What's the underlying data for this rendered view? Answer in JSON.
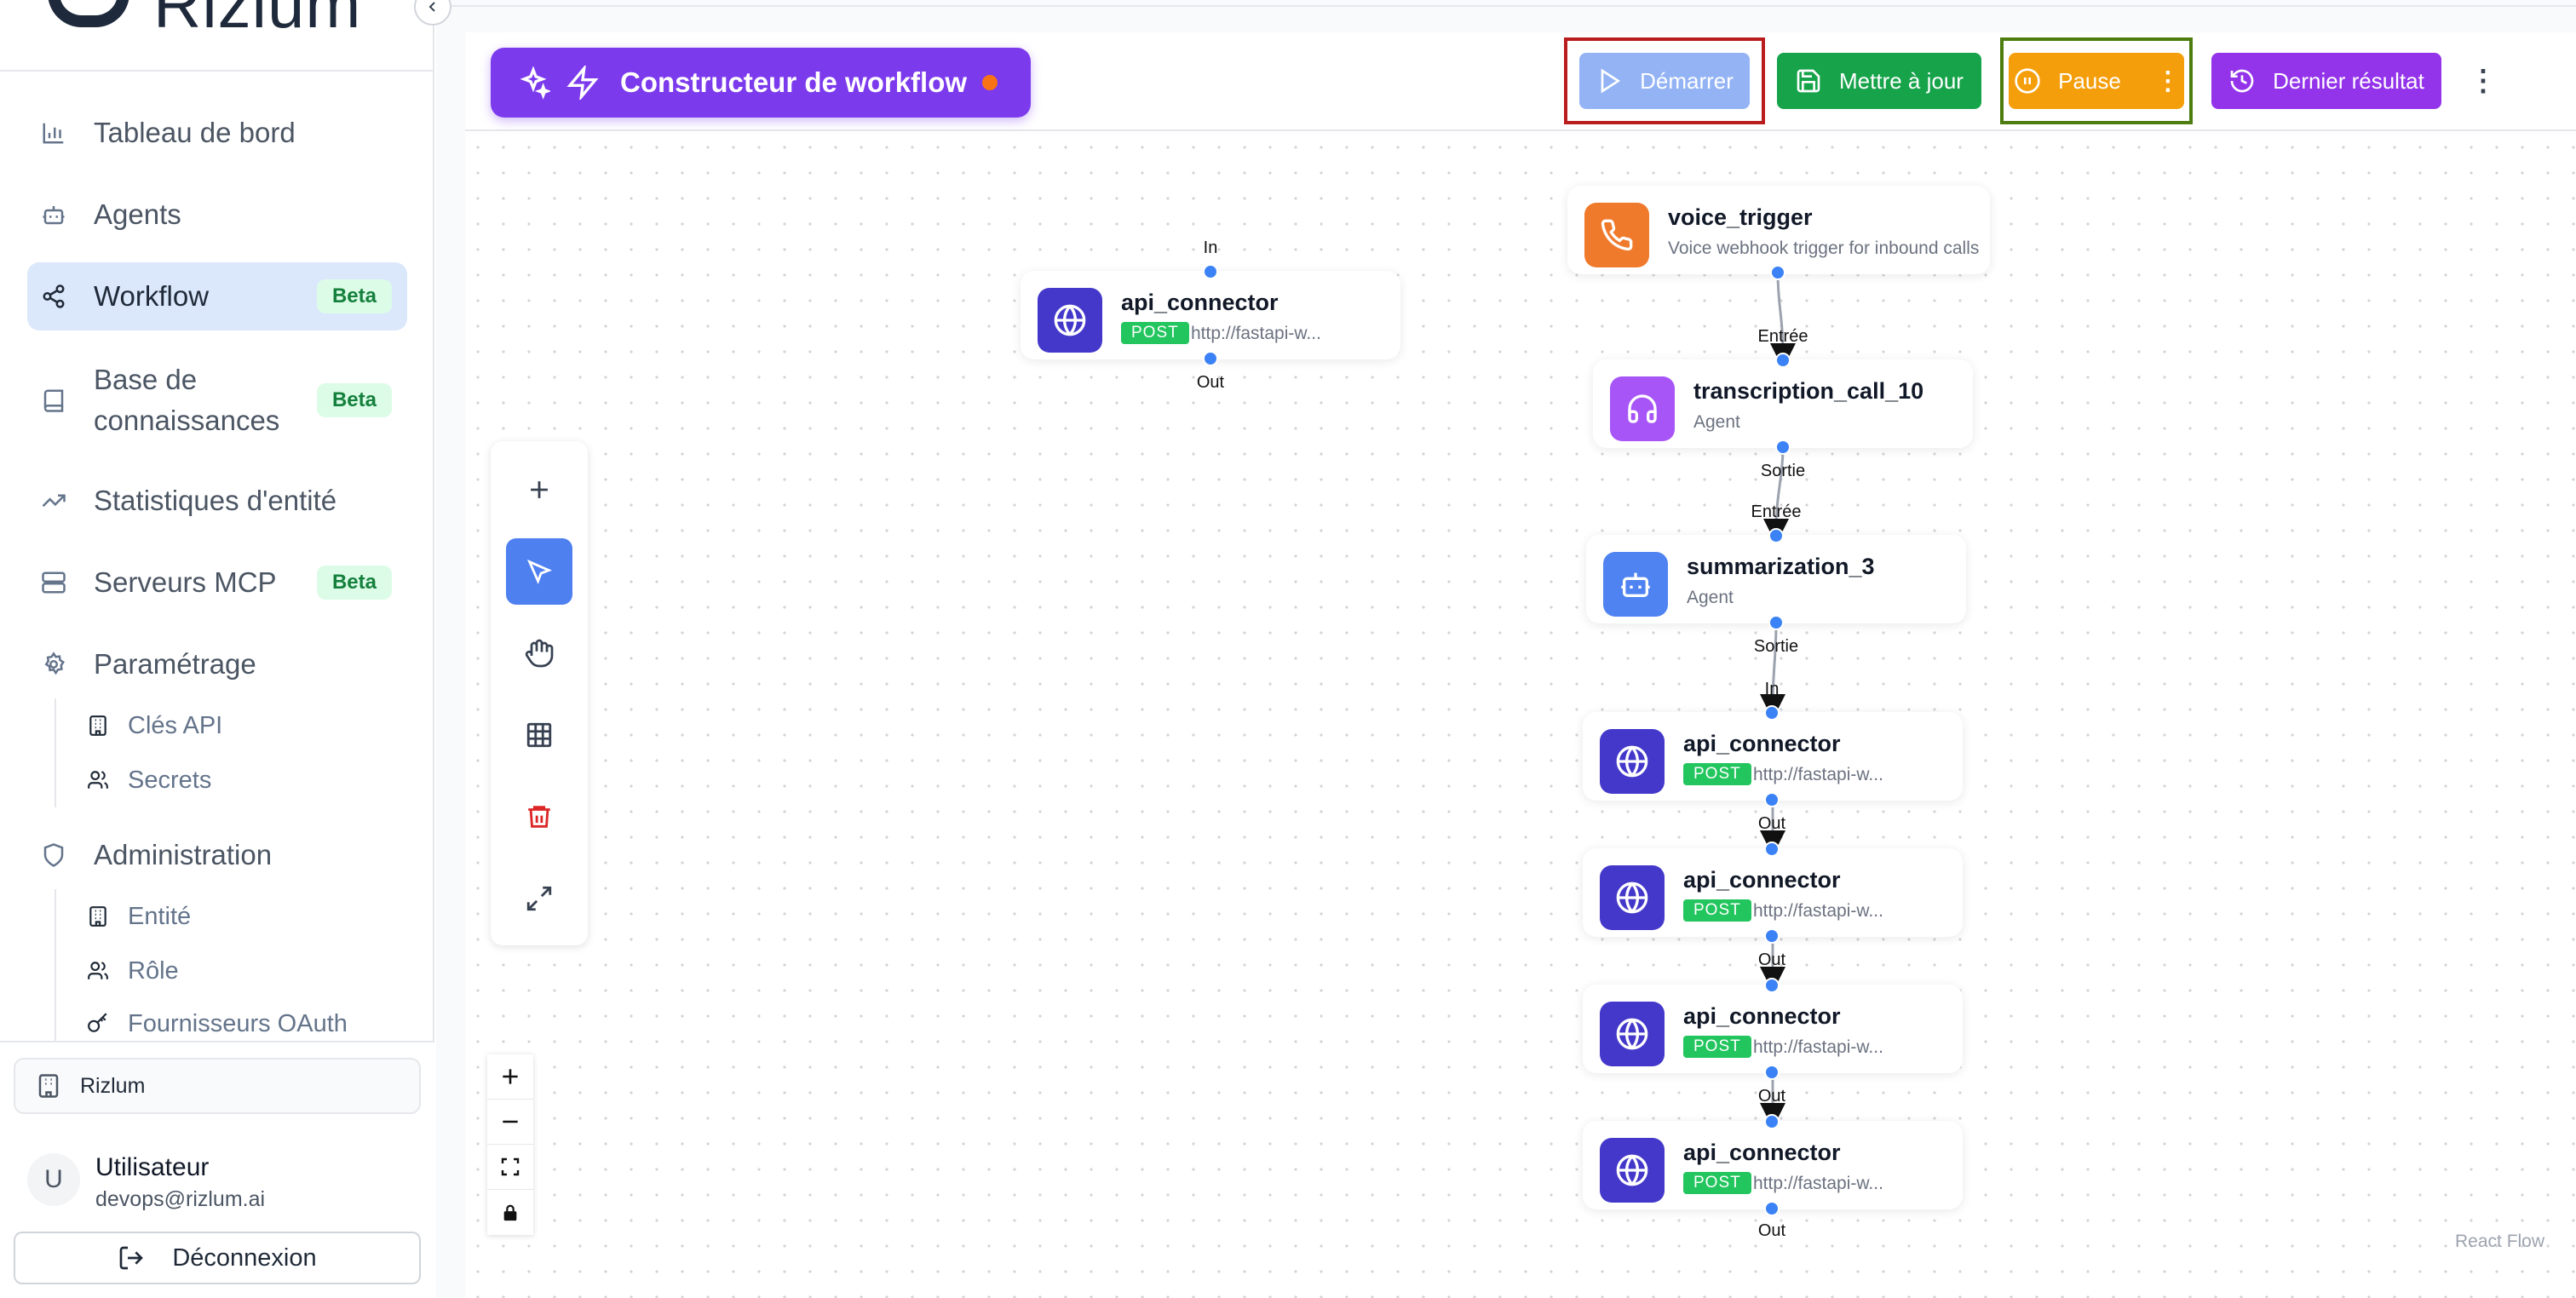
{
  "brand": {
    "name": "Rizlum"
  },
  "sidebar": {
    "items": [
      {
        "label": "Tableau de bord"
      },
      {
        "label": "Agents"
      },
      {
        "label": "Workflow",
        "badge": "Beta"
      },
      {
        "label": "Base de connaissances",
        "badge": "Beta"
      },
      {
        "label": "Statistiques d'entité"
      },
      {
        "label": "Serveurs MCP",
        "badge": "Beta"
      },
      {
        "label": "Paramétrage"
      },
      {
        "label": "Administration"
      }
    ],
    "settings_sub": [
      {
        "label": "Clés API"
      },
      {
        "label": "Secrets"
      }
    ],
    "admin_sub": [
      {
        "label": "Entité"
      },
      {
        "label": "Rôle"
      },
      {
        "label": "Fournisseurs OAuth"
      }
    ],
    "org": "Rizlum",
    "user": {
      "initial": "U",
      "name": "Utilisateur",
      "email": "devops@rizlum.ai"
    },
    "logout": "Déconnexion"
  },
  "header": {
    "title": "Constructeur de workflow",
    "buttons": {
      "start": "Démarrer",
      "update": "Mettre à jour",
      "pause": "Pause",
      "last_result": "Dernier résultat"
    }
  },
  "canvas": {
    "attribution": "React Flow",
    "nodes": [
      {
        "title": "api_connector",
        "method": "POST",
        "url": "http://fastapi-w...",
        "in": "In",
        "out": "Out"
      },
      {
        "title": "voice_trigger",
        "subtitle": "Voice webhook trigger for inbound calls"
      },
      {
        "title": "transcription_call_10",
        "subtitle": "Agent",
        "in": "Entrée",
        "out": "Sortie"
      },
      {
        "title": "summarization_3",
        "subtitle": "Agent",
        "in": "Entrée",
        "out": "Sortie"
      },
      {
        "title": "api_connector",
        "method": "POST",
        "url": "http://fastapi-w...",
        "in": "In",
        "out": "Out"
      },
      {
        "title": "api_connector",
        "method": "POST",
        "url": "http://fastapi-w...",
        "out": "Out"
      },
      {
        "title": "api_connector",
        "method": "POST",
        "url": "http://fastapi-w...",
        "out": "Out"
      },
      {
        "title": "api_connector",
        "method": "POST",
        "url": "http://fastapi-w...",
        "out": "Out"
      }
    ]
  },
  "colors": {
    "accent": "#7c3aed",
    "start": "#93b3f5",
    "update": "#16a34a",
    "pause": "#f59e0b",
    "last_result": "#9333ea",
    "handle": "#3b82f6",
    "api_icon": "#4338ca",
    "trigger_icon": "#f97316",
    "agent_icon": "#a855f7",
    "summary_icon": "#3b82f6"
  }
}
